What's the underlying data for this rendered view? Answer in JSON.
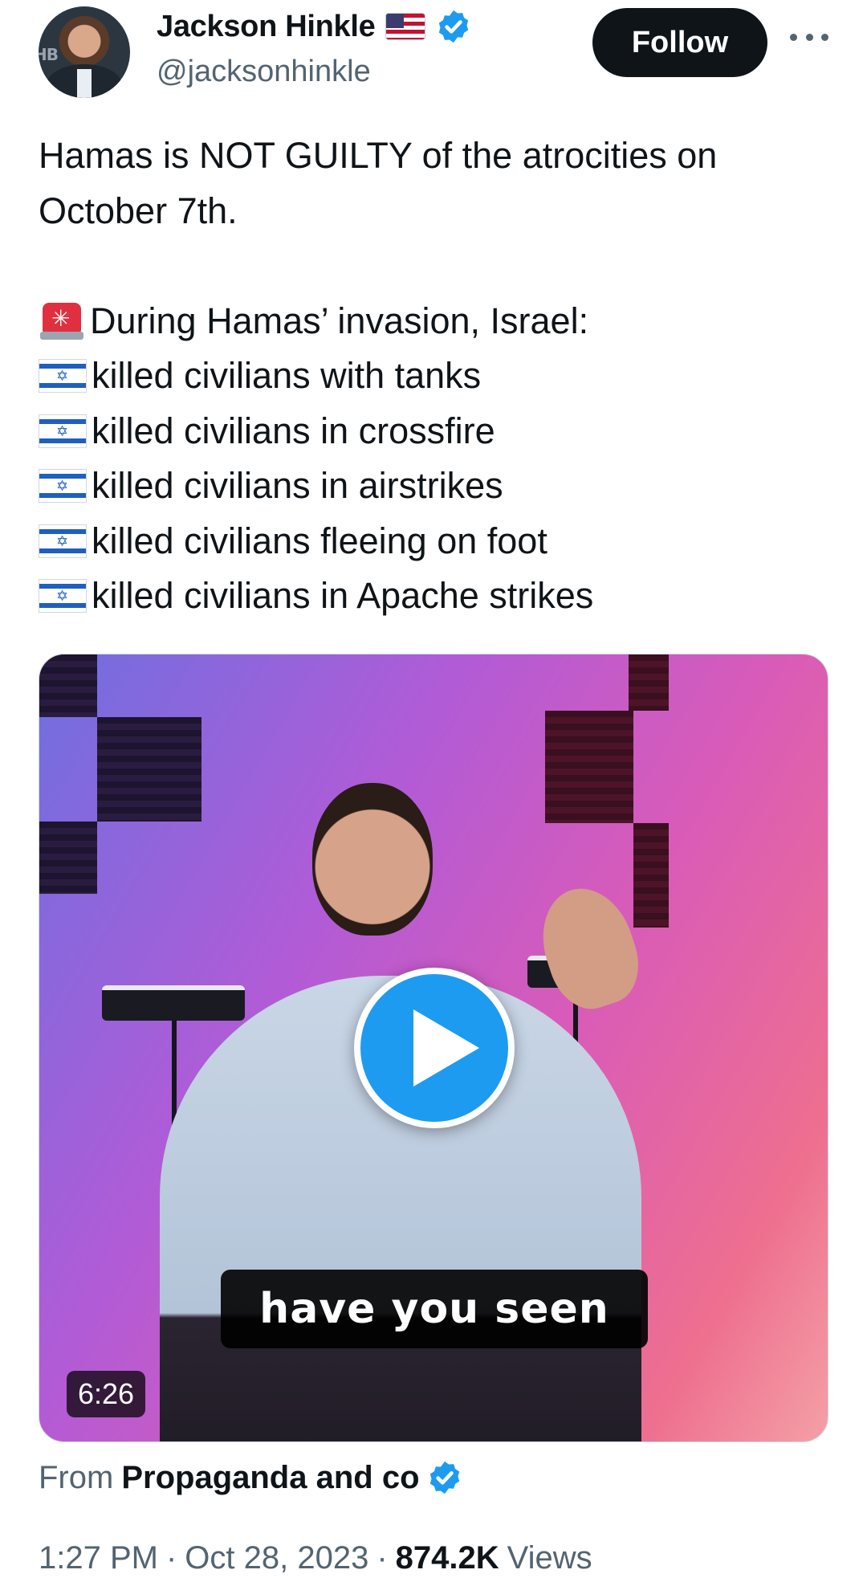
{
  "author": {
    "display_name": "Jackson Hinkle",
    "handle": "@jacksonhinkle",
    "flag_icon": "us-flag-icon",
    "verified_icon": "verified-badge-icon"
  },
  "actions": {
    "follow_label": "Follow",
    "more_icon": "more-icon"
  },
  "tweet": {
    "lines": [
      "Hamas is NOT GUILTY of the atrocities on",
      "October 7th."
    ],
    "list_header": "During Hamas’ invasion, Israel:",
    "list_header_icon": "siren-icon",
    "list_item_icon": "israel-flag-icon",
    "items": [
      "killed civilians with tanks",
      "killed civilians in crossfire",
      "killed civilians in airstrikes",
      "killed civilians fleeing on foot",
      "killed civilians in Apache strikes"
    ]
  },
  "media": {
    "caption": "have you seen",
    "duration": "6:26",
    "play_icon": "play-icon"
  },
  "attribution": {
    "prefix": "From",
    "source": "Propaganda and co"
  },
  "meta": {
    "time": "1:27 PM",
    "date": "Oct 28, 2023",
    "separator": "·",
    "views_count": "874.2K",
    "views_label": "Views"
  },
  "colors": {
    "text_primary": "#0f1419",
    "text_secondary": "#536471",
    "accent_blue": "#1d9bf0",
    "follow_bg": "#0f1419"
  }
}
